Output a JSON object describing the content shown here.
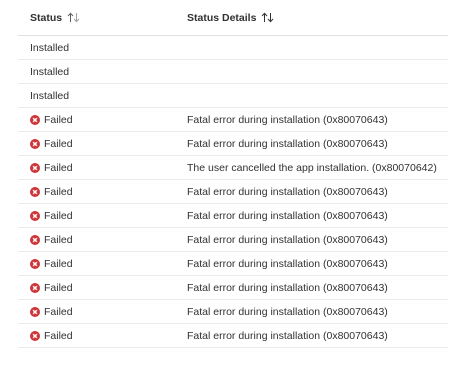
{
  "columns": {
    "status": "Status",
    "details": "Status Details"
  },
  "colors": {
    "error": "#d13438",
    "text": "#323130",
    "divider": "#edebe9"
  },
  "icons": {
    "sort": "sort-arrows-icon",
    "error": "error-circle-icon"
  },
  "rows": [
    {
      "status": "Installed",
      "failed": false,
      "details": ""
    },
    {
      "status": "Installed",
      "failed": false,
      "details": ""
    },
    {
      "status": "Installed",
      "failed": false,
      "details": ""
    },
    {
      "status": "Failed",
      "failed": true,
      "details": "Fatal error during installation (0x80070643)"
    },
    {
      "status": "Failed",
      "failed": true,
      "details": "Fatal error during installation (0x80070643)"
    },
    {
      "status": "Failed",
      "failed": true,
      "details": "The user cancelled the app installation. (0x80070642)"
    },
    {
      "status": "Failed",
      "failed": true,
      "details": "Fatal error during installation (0x80070643)"
    },
    {
      "status": "Failed",
      "failed": true,
      "details": "Fatal error during installation (0x80070643)"
    },
    {
      "status": "Failed",
      "failed": true,
      "details": "Fatal error during installation (0x80070643)"
    },
    {
      "status": "Failed",
      "failed": true,
      "details": "Fatal error during installation (0x80070643)"
    },
    {
      "status": "Failed",
      "failed": true,
      "details": "Fatal error during installation (0x80070643)"
    },
    {
      "status": "Failed",
      "failed": true,
      "details": "Fatal error during installation (0x80070643)"
    },
    {
      "status": "Failed",
      "failed": true,
      "details": "Fatal error during installation (0x80070643)"
    }
  ]
}
